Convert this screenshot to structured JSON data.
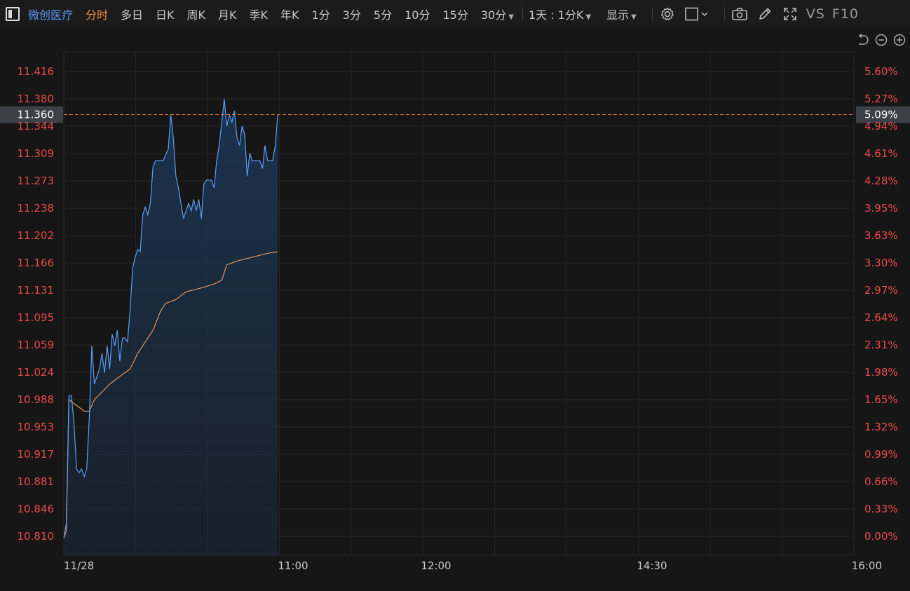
{
  "toolbar": {
    "stock_name": "微创医疗",
    "tabs": [
      {
        "label": "分时",
        "active": true
      },
      {
        "label": "多日",
        "active": false
      },
      {
        "label": "日K",
        "active": false
      },
      {
        "label": "周K",
        "active": false
      },
      {
        "label": "月K",
        "active": false
      },
      {
        "label": "季K",
        "active": false
      },
      {
        "label": "年K",
        "active": false
      },
      {
        "label": "1分",
        "active": false
      },
      {
        "label": "3分",
        "active": false
      },
      {
        "label": "5分",
        "active": false
      },
      {
        "label": "10分",
        "active": false
      },
      {
        "label": "15分",
        "active": false
      },
      {
        "label": "30分",
        "active": false
      }
    ],
    "period_select": "1天 : 1分K",
    "display_select": "显示",
    "vs_label": "VS",
    "f10_label": "F10",
    "icons": [
      "panel-toggle-icon",
      "gear-icon",
      "box-icon",
      "camera-icon",
      "pencil-icon",
      "fullscreen-icon",
      "undo-icon",
      "zoom-out-icon",
      "zoom-in-icon"
    ]
  },
  "colors": {
    "background": "#161616",
    "price_line": "#5b9cf6",
    "avg_line": "#e8935a",
    "axis_label": "#e84a4a",
    "grid": "#262626",
    "crosshair": "#e87a3c",
    "crosshair_box": "#3c4148"
  },
  "chart_data": {
    "type": "line",
    "title": "",
    "xlabel": "",
    "ylabel": "",
    "ylim": [
      10.81,
      11.452
    ],
    "y_ticks": [
      "11.416",
      "11.380",
      "11.344",
      "11.309",
      "11.273",
      "11.238",
      "11.202",
      "11.166",
      "11.131",
      "11.095",
      "11.059",
      "11.024",
      "10.988",
      "10.953",
      "10.917",
      "10.881",
      "10.846",
      "10.810"
    ],
    "pct_ticks": [
      "5.60%",
      "5.27%",
      "4.94%",
      "4.61%",
      "4.28%",
      "3.95%",
      "3.63%",
      "3.30%",
      "2.97%",
      "2.64%",
      "2.31%",
      "1.98%",
      "1.65%",
      "1.32%",
      "0.99%",
      "0.66%",
      "0.33%",
      "0.00%"
    ],
    "x_labels": [
      {
        "label": "11/28",
        "time": "09:30"
      },
      {
        "label": "11:00",
        "time": "11:00"
      },
      {
        "label": "12:00",
        "time": "12:00"
      },
      {
        "label": "14:30",
        "time": "14:30"
      },
      {
        "label": "16:00",
        "time": "16:00"
      }
    ],
    "crosshair": {
      "price": "11.360",
      "pct": "5.09%",
      "value": 11.36
    },
    "series": [
      {
        "key": "price",
        "points": [
          [
            "09:30",
            10.81
          ],
          [
            "09:31",
            10.83
          ],
          [
            "09:32",
            10.995
          ],
          [
            "09:33",
            10.995
          ],
          [
            "09:34",
            10.96
          ],
          [
            "09:35",
            10.9
          ],
          [
            "09:36",
            10.895
          ],
          [
            "09:37",
            10.9
          ],
          [
            "09:38",
            10.89
          ],
          [
            "09:39",
            10.9
          ],
          [
            "09:40",
            10.965
          ],
          [
            "09:41",
            11.06
          ],
          [
            "09:42",
            11.01
          ],
          [
            "09:43",
            11.02
          ],
          [
            "09:44",
            11.03
          ],
          [
            "09:45",
            11.05
          ],
          [
            "09:46",
            11.025
          ],
          [
            "09:47",
            11.06
          ],
          [
            "09:48",
            11.03
          ],
          [
            "09:49",
            11.075
          ],
          [
            "09:50",
            11.06
          ],
          [
            "09:51",
            11.08
          ],
          [
            "09:52",
            11.04
          ],
          [
            "09:53",
            11.07
          ],
          [
            "09:54",
            11.07
          ],
          [
            "09:55",
            11.065
          ],
          [
            "09:56",
            11.105
          ],
          [
            "09:57",
            11.16
          ],
          [
            "09:58",
            11.175
          ],
          [
            "09:59",
            11.185
          ],
          [
            "10:00",
            11.182
          ],
          [
            "10:01",
            11.23
          ],
          [
            "10:02",
            11.24
          ],
          [
            "10:03",
            11.23
          ],
          [
            "10:04",
            11.245
          ],
          [
            "10:05",
            11.292
          ],
          [
            "10:06",
            11.3
          ],
          [
            "10:07",
            11.3
          ],
          [
            "10:08",
            11.3
          ],
          [
            "10:09",
            11.3
          ],
          [
            "10:10",
            11.308
          ],
          [
            "10:11",
            11.315
          ],
          [
            "10:12",
            11.36
          ],
          [
            "10:13",
            11.33
          ],
          [
            "10:14",
            11.28
          ],
          [
            "10:15",
            11.265
          ],
          [
            "10:16",
            11.245
          ],
          [
            "10:17",
            11.225
          ],
          [
            "10:18",
            11.235
          ],
          [
            "10:19",
            11.245
          ],
          [
            "10:20",
            11.235
          ],
          [
            "10:21",
            11.25
          ],
          [
            "10:22",
            11.235
          ],
          [
            "10:23",
            11.25
          ],
          [
            "10:24",
            11.225
          ],
          [
            "10:25",
            11.27
          ],
          [
            "10:26",
            11.275
          ],
          [
            "10:27",
            11.275
          ],
          [
            "10:28",
            11.275
          ],
          [
            "10:29",
            11.265
          ],
          [
            "10:30",
            11.3
          ],
          [
            "10:31",
            11.32
          ],
          [
            "10:32",
            11.35
          ],
          [
            "10:33",
            11.38
          ],
          [
            "10:34",
            11.345
          ],
          [
            "10:35",
            11.36
          ],
          [
            "10:36",
            11.35
          ],
          [
            "10:37",
            11.365
          ],
          [
            "10:38",
            11.33
          ],
          [
            "10:39",
            11.32
          ],
          [
            "10:40",
            11.345
          ],
          [
            "10:41",
            11.335
          ],
          [
            "10:42",
            11.28
          ],
          [
            "10:43",
            11.31
          ],
          [
            "10:44",
            11.3
          ],
          [
            "10:45",
            11.3
          ],
          [
            "10:46",
            11.3
          ],
          [
            "10:47",
            11.3
          ],
          [
            "10:48",
            11.29
          ],
          [
            "10:49",
            11.32
          ],
          [
            "10:50",
            11.3
          ],
          [
            "10:51",
            11.3
          ],
          [
            "10:52",
            11.3
          ],
          [
            "10:53",
            11.32
          ],
          [
            "10:54",
            11.36
          ]
        ]
      },
      {
        "key": "average",
        "points": [
          [
            "09:30",
            10.81
          ],
          [
            "09:31",
            10.82
          ],
          [
            "09:32",
            10.99
          ],
          [
            "09:34",
            10.985
          ],
          [
            "09:38",
            10.975
          ],
          [
            "09:40",
            10.975
          ],
          [
            "09:42",
            10.99
          ],
          [
            "09:45",
            11.0
          ],
          [
            "09:48",
            11.01
          ],
          [
            "09:52",
            11.02
          ],
          [
            "09:56",
            11.03
          ],
          [
            "09:59",
            11.05
          ],
          [
            "10:02",
            11.065
          ],
          [
            "10:05",
            11.08
          ],
          [
            "10:08",
            11.105
          ],
          [
            "10:10",
            11.115
          ],
          [
            "10:14",
            11.12
          ],
          [
            "10:18",
            11.13
          ],
          [
            "10:24",
            11.135
          ],
          [
            "10:29",
            11.14
          ],
          [
            "10:32",
            11.145
          ],
          [
            "10:34",
            11.165
          ],
          [
            "10:38",
            11.17
          ],
          [
            "10:44",
            11.175
          ],
          [
            "10:50",
            11.18
          ],
          [
            "10:54",
            11.182
          ]
        ]
      }
    ]
  }
}
